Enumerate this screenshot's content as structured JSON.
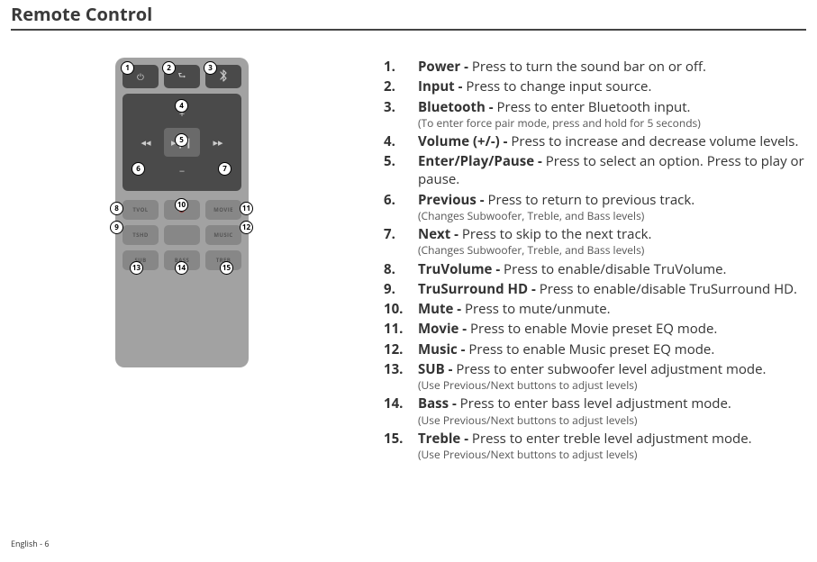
{
  "title": "Remote Control",
  "footer": "English - 6",
  "remote": {
    "row1": [
      {
        "icon": "power"
      },
      {
        "icon": "input"
      },
      {
        "icon": "bluetooth"
      }
    ],
    "dpad": {
      "up": "+",
      "down": "−",
      "left": "◂◂",
      "right": "▸▸",
      "center": "▸❙❙"
    },
    "row2": [
      {
        "text": "TVOL"
      },
      {
        "icon": "mute"
      },
      {
        "text": "MOVIE"
      }
    ],
    "row3": [
      {
        "text": "TSHD"
      },
      {
        "text": ""
      },
      {
        "text": "MUSIC"
      }
    ],
    "row4": [
      {
        "text": "SUB"
      },
      {
        "text": "BASS"
      },
      {
        "text": "TREB"
      }
    ]
  },
  "callouts": {
    "c1": "1",
    "c2": "2",
    "c3": "3",
    "c4": "4",
    "c5": "5",
    "c6": "6",
    "c7": "7",
    "c8": "8",
    "c9": "9",
    "c10": "10",
    "c11": "11",
    "c12": "12",
    "c13": "13",
    "c14": "14",
    "c15": "15"
  },
  "instructions": [
    {
      "num": "1.",
      "label": "Power - ",
      "desc": "Press to turn the sound bar on or off."
    },
    {
      "num": "2.",
      "label": "Input - ",
      "desc": "Press to change input source."
    },
    {
      "num": "3.",
      "label": "Bluetooth - ",
      "desc": "Press to enter Bluetooth input.",
      "note": "(To enter force pair mode, press and hold for 5 seconds)"
    },
    {
      "num": "4.",
      "label": "Volume (+/-) - ",
      "desc": "Press to increase and decrease volume levels."
    },
    {
      "num": "5.",
      "label": "Enter/Play/Pause - ",
      "desc": "Press to select an option. Press to play or pause."
    },
    {
      "num": "6.",
      "label": "Previous - ",
      "desc": "Press to return to previous track.",
      "note": "(Changes Subwoofer, Treble, and Bass levels)"
    },
    {
      "num": "7.",
      "label": "Next - ",
      "desc": "Press to skip to the next track.",
      "note": "(Changes Subwoofer, Treble, and Bass levels)"
    },
    {
      "num": "8.",
      "label": "TruVolume - ",
      "desc": "Press to enable/disable TruVolume."
    },
    {
      "num": "9.",
      "label": "TruSurround HD - ",
      "desc": "Press to enable/disable TruSurround HD."
    },
    {
      "num": "10.",
      "label": "Mute - ",
      "desc": "Press to mute/unmute."
    },
    {
      "num": "11.",
      "label": "Movie - ",
      "desc": "Press to enable Movie preset EQ mode."
    },
    {
      "num": "12.",
      "label": "Music - ",
      "desc": "Press to enable Music preset EQ mode."
    },
    {
      "num": "13.",
      "label": "SUB - ",
      "desc": "Press to enter subwoofer level adjustment mode.",
      "note": "(Use Previous/Next buttons to adjust levels)"
    },
    {
      "num": "14.",
      "label": "Bass - ",
      "desc": "Press to enter bass level adjustment mode.",
      "note": "(Use Previous/Next buttons to adjust levels)"
    },
    {
      "num": "15.",
      "label": "Treble - ",
      "desc": "Press to enter treble level adjustment mode.",
      "note": "(Use Previous/Next buttons to adjust levels)"
    }
  ]
}
